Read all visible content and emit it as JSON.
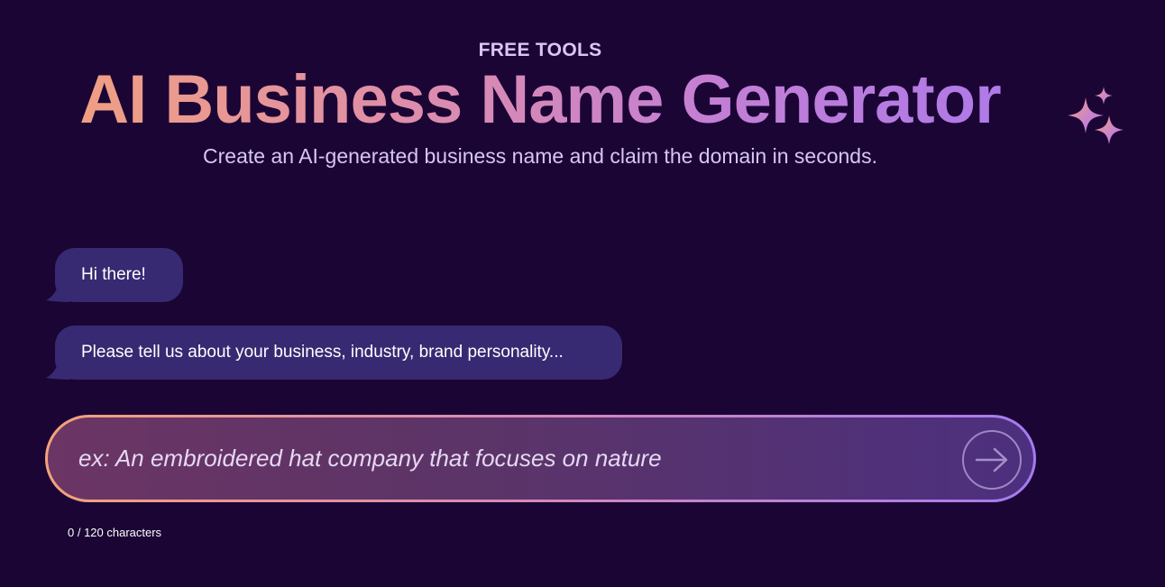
{
  "header": {
    "eyebrow": "FREE TOOLS",
    "title": "AI Business Name Generator",
    "subtitle": "Create an AI-generated business name and claim the domain in seconds.",
    "decoration_icon": "sparkles-icon"
  },
  "chat": {
    "messages": [
      {
        "text": "Hi there!"
      },
      {
        "text": "Please tell us about your business, industry, brand personality..."
      }
    ]
  },
  "input": {
    "value": "",
    "placeholder": "ex: An embroidered hat company that focuses on nature",
    "submit_icon": "arrow-right-icon",
    "counter": "0 / 120 characters"
  },
  "colors": {
    "background": "#1b0535",
    "bubble": "#372a72",
    "gradient_start": "#f4a37a",
    "gradient_end": "#a978ee",
    "subtitle": "#d7c6f5"
  }
}
